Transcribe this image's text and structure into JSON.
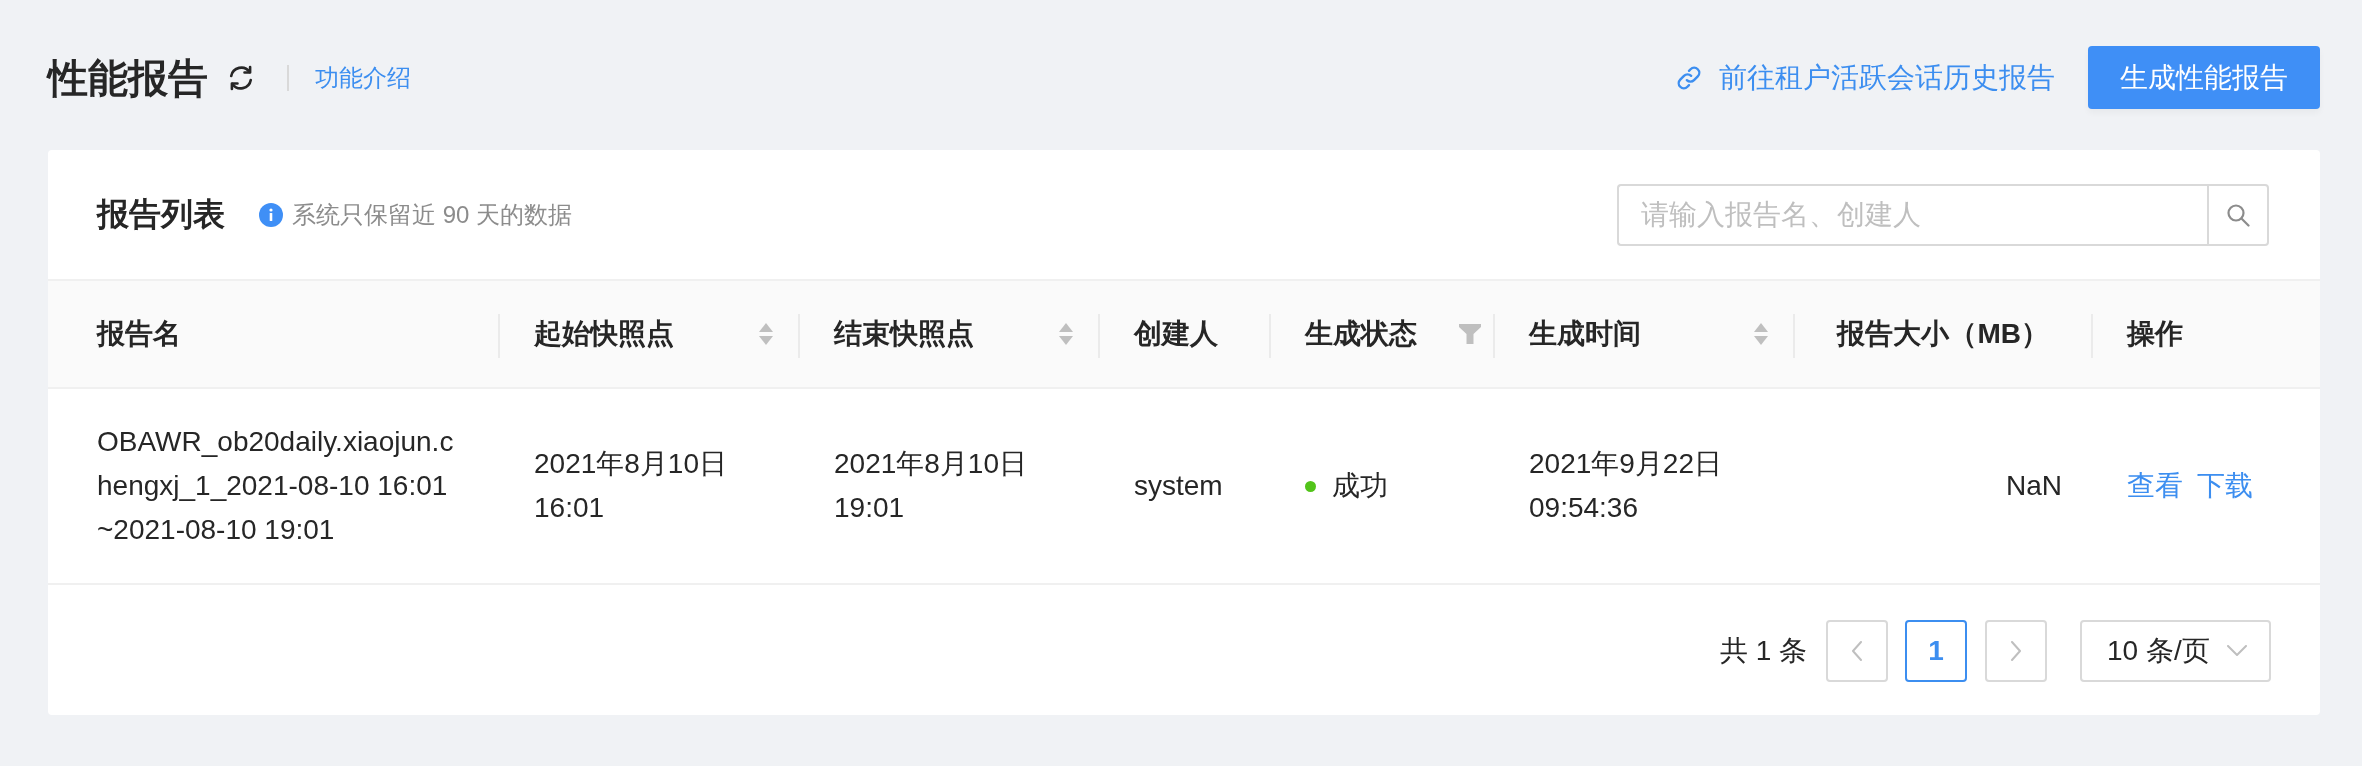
{
  "header": {
    "title": "性能报告",
    "intro_link": "功能介绍",
    "history_link": "前往租户活跃会话历史报告",
    "primary_button": "生成性能报告"
  },
  "report_list": {
    "title": "报告列表",
    "notice": "系统只保留近 90 天的数据",
    "search": {
      "placeholder": "请输入报告名、创建人"
    }
  },
  "table": {
    "columns": [
      {
        "label": "报告名",
        "kind": "plain"
      },
      {
        "label": "起始快照点",
        "kind": "sortable"
      },
      {
        "label": "结束快照点",
        "kind": "sortable"
      },
      {
        "label": "创建人",
        "kind": "plain"
      },
      {
        "label": "生成状态",
        "kind": "filterable"
      },
      {
        "label": "生成时间",
        "kind": "sortable"
      },
      {
        "label": "报告大小（MB）",
        "kind": "numeric"
      },
      {
        "label": "操作",
        "kind": "plain"
      }
    ],
    "rows": [
      {
        "cells": [
          {
            "kind": "text",
            "text": "OBAWR_ob20daily.xiaojun.chengxj_1_2021-08-10 16:01~2021-08-10 19:01"
          },
          {
            "kind": "text",
            "text": "2021年8月10日 16:01"
          },
          {
            "kind": "text",
            "text": "2021年8月10日 19:01"
          },
          {
            "kind": "text",
            "text": "system"
          },
          {
            "kind": "status",
            "text": "成功",
            "color": "#52c41a"
          },
          {
            "kind": "text",
            "text": "2021年9月22日 09:54:36"
          },
          {
            "kind": "numeric",
            "text": "NaN"
          },
          {
            "kind": "actions",
            "links": [
              "查看",
              "下载"
            ]
          }
        ]
      }
    ]
  },
  "pagination": {
    "total": "共 1 条",
    "prev": {
      "disabled": true
    },
    "pages": [
      {
        "label": "1",
        "selected": true
      }
    ],
    "next": {
      "disabled": true
    },
    "page_size": "10 条/页"
  }
}
